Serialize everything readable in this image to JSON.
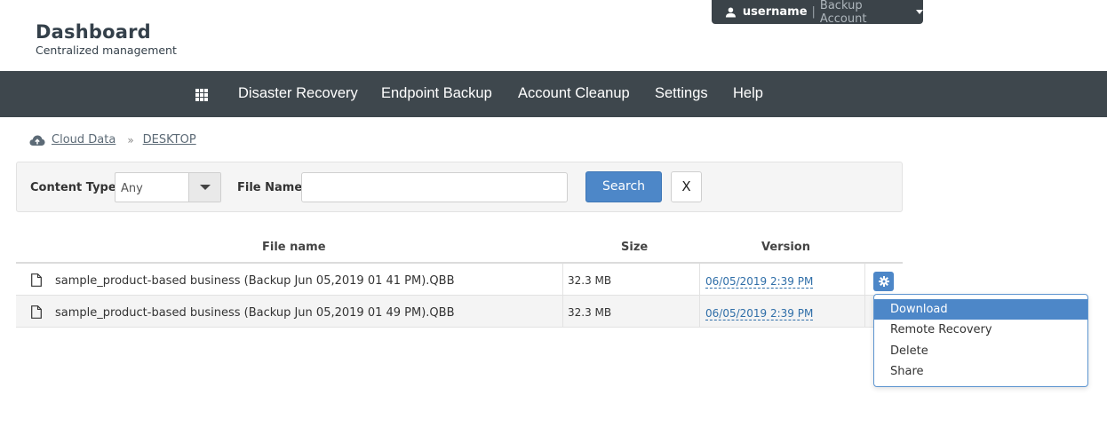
{
  "brand": {
    "title": "Dashboard",
    "subtitle": "Centralized management"
  },
  "user_menu": {
    "username": "username",
    "separator": "|",
    "account": "Backup Account"
  },
  "nav": {
    "items": [
      {
        "label": "Disaster Recovery"
      },
      {
        "label": "Endpoint Backup"
      },
      {
        "label": "Account Cleanup"
      },
      {
        "label": "Settings"
      },
      {
        "label": "Help"
      }
    ]
  },
  "breadcrumb": {
    "root": "Cloud Data",
    "separator": "»",
    "current": "DESKTOP"
  },
  "filter": {
    "content_type_label": "Content Type",
    "content_type_value": "Any",
    "file_name_label": "File Name",
    "file_name_value": "",
    "search_label": "Search",
    "clear_label": "X"
  },
  "table": {
    "headers": {
      "file_name": "File name",
      "size": "Size",
      "version": "Version"
    },
    "rows": [
      {
        "file_name": "sample_product-based business (Backup Jun 05,2019 01 41 PM).QBB",
        "size": "32.3 MB",
        "version": "06/05/2019 2:39 PM"
      },
      {
        "file_name": "sample_product-based business (Backup Jun 05,2019 01 49 PM).QBB",
        "size": "32.3 MB",
        "version": "06/05/2019 2:39 PM"
      }
    ]
  },
  "row_menu": {
    "items": [
      {
        "label": "Download",
        "active": true
      },
      {
        "label": "Remote Recovery"
      },
      {
        "label": "Delete"
      },
      {
        "label": "Share"
      }
    ]
  },
  "colors": {
    "navbar": "#3e474d",
    "accent": "#4d87c8",
    "link": "#2f6ea8"
  }
}
